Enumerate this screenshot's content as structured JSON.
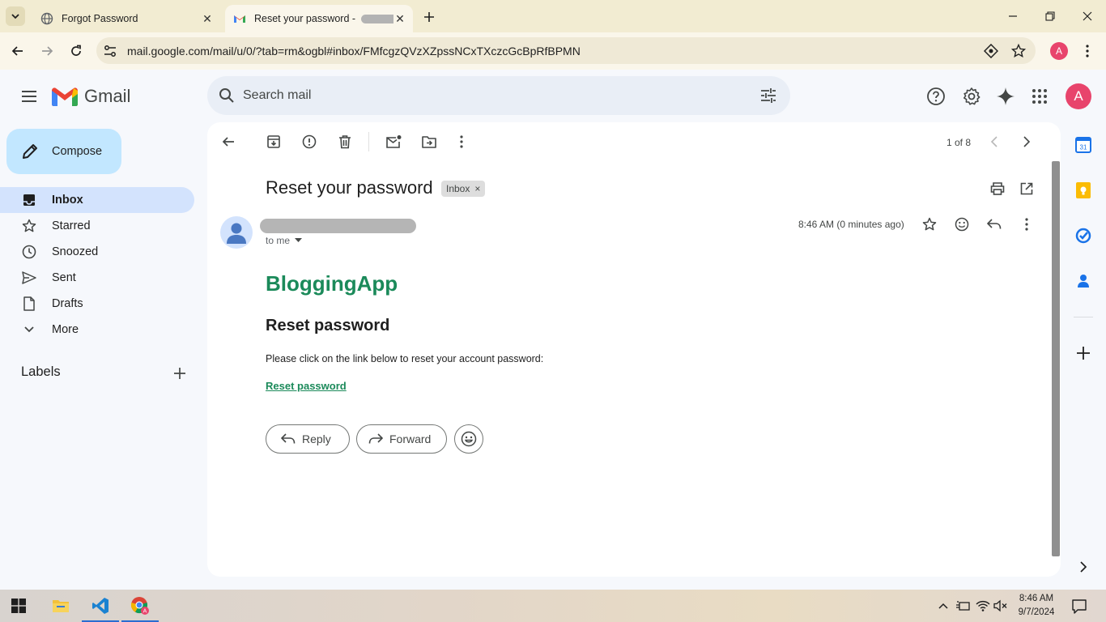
{
  "browser": {
    "tabs": [
      {
        "title": "Forgot Password",
        "favicon": "globe-icon",
        "active": false
      },
      {
        "title": "Reset your password - ",
        "favicon": "gmail-icon",
        "active": true
      }
    ],
    "url": "mail.google.com/mail/u/0/?tab=rm&ogbl#inbox/FMfcgzQVzXZpssNCxTXczcGcBpRfBPMN",
    "profile_initial": "A",
    "accent_color": "#e8446c"
  },
  "gmail": {
    "product_name": "Gmail",
    "search_placeholder": "Search mail",
    "account_initial": "A",
    "compose_label": "Compose",
    "nav": [
      {
        "label": "Inbox",
        "icon": "inbox-icon",
        "active": true
      },
      {
        "label": "Starred",
        "icon": "star-icon",
        "active": false
      },
      {
        "label": "Snoozed",
        "icon": "clock-icon",
        "active": false
      },
      {
        "label": "Sent",
        "icon": "send-icon",
        "active": false
      },
      {
        "label": "Drafts",
        "icon": "draft-icon",
        "active": false
      },
      {
        "label": "More",
        "icon": "chevron-down-icon",
        "active": false
      }
    ],
    "labels_heading": "Labels"
  },
  "message": {
    "pager": "1 of 8",
    "subject": "Reset your password",
    "chip_label": "Inbox",
    "chip_close": "×",
    "recipient": "to me",
    "timestamp": "8:46 AM (0 minutes ago)",
    "brand": "BloggingApp",
    "heading": "Reset password",
    "body": "Please click on the link below to reset your account password:",
    "link_text": "Reset password",
    "reply_label": "Reply",
    "forward_label": "Forward",
    "brand_color": "#1b8a5a"
  },
  "taskbar": {
    "time": "8:46 AM",
    "date": "9/7/2024"
  }
}
